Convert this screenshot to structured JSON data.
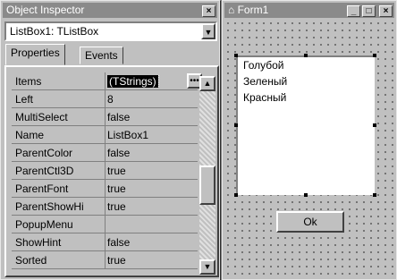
{
  "object_inspector": {
    "title": "Object Inspector",
    "close_label": "×",
    "component_selector": "ListBox1: TListBox",
    "tabs": [
      {
        "label": "Properties",
        "active": true
      },
      {
        "label": "Events",
        "active": false
      }
    ],
    "properties": [
      {
        "name": "Items",
        "value": "(TStrings)"
      },
      {
        "name": "Left",
        "value": "8"
      },
      {
        "name": "MultiSelect",
        "value": "false"
      },
      {
        "name": "Name",
        "value": "ListBox1"
      },
      {
        "name": "ParentColor",
        "value": "false"
      },
      {
        "name": "ParentCtl3D",
        "value": "true"
      },
      {
        "name": "ParentFont",
        "value": "true"
      },
      {
        "name": "ParentShowHi",
        "value": "true"
      },
      {
        "name": "PopupMenu",
        "value": ""
      },
      {
        "name": "ShowHint",
        "value": "false"
      },
      {
        "name": "Sorted",
        "value": "true"
      }
    ],
    "ellipsis_label": "•••"
  },
  "form1": {
    "title": "Form1",
    "buttons": {
      "minimize": "_",
      "maximize": "□",
      "close": "×"
    },
    "listbox_items": [
      "Голубой",
      "Зеленый",
      "Красный"
    ],
    "ok_button": "Ok"
  }
}
